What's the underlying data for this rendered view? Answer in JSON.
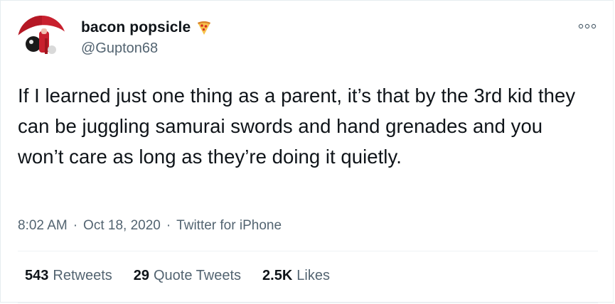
{
  "author": {
    "display_name": "bacon popsicle",
    "name_emoji_icon": "pizza-icon",
    "handle": "@Gupton68"
  },
  "tweet": {
    "text": "If I learned just one thing as a parent, it’s that by the 3rd kid they can be juggling samurai swords and hand grenades and you won’t care as long as they’re doing it quietly."
  },
  "meta": {
    "time": "8:02 AM",
    "separator": "·",
    "date": "Oct 18, 2020",
    "source": "Twitter for iPhone"
  },
  "stats": {
    "retweets_count": "543",
    "retweets_label": "Retweets",
    "quotes_count": "29",
    "quotes_label": "Quote Tweets",
    "likes_count": "2.5K",
    "likes_label": "Likes"
  },
  "colors": {
    "text": "#0f1419",
    "secondary_text": "#536471",
    "border": "#eff3f4"
  }
}
